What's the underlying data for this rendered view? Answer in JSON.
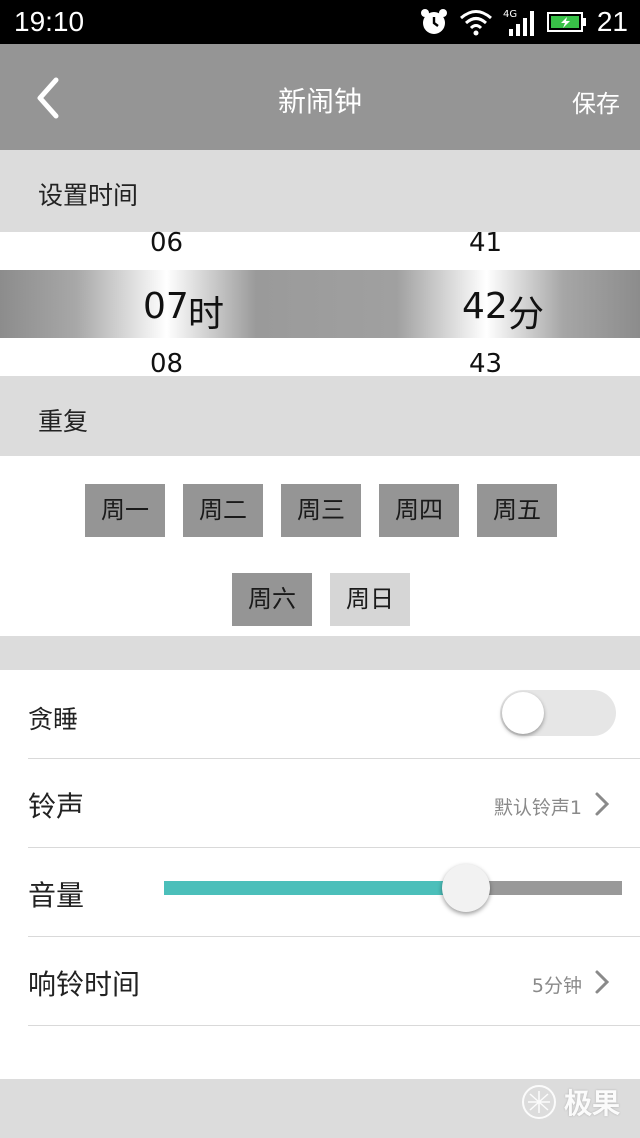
{
  "status_bar": {
    "time": "19:10",
    "network": "4G",
    "battery": "21",
    "icons": [
      "alarm-icon",
      "wifi-icon",
      "signal-icon",
      "battery-icon"
    ]
  },
  "app_bar": {
    "title": "新闹钟",
    "save_label": "保存",
    "back_icon": "chevron-left-icon"
  },
  "set_time": {
    "label": "设置时间",
    "hour": {
      "prev": "06",
      "selected": "07",
      "unit": "时",
      "next": "08"
    },
    "minute": {
      "prev": "41",
      "selected": "42",
      "unit": "分",
      "next": "43"
    }
  },
  "repeat": {
    "label": "重复",
    "days": [
      {
        "label": "周一",
        "selected": true
      },
      {
        "label": "周二",
        "selected": true
      },
      {
        "label": "周三",
        "selected": true
      },
      {
        "label": "周四",
        "selected": true
      },
      {
        "label": "周五",
        "selected": true
      },
      {
        "label": "周六",
        "selected": true
      },
      {
        "label": "周日",
        "selected": false
      }
    ]
  },
  "settings": {
    "snooze": {
      "label": "贪睡",
      "enabled": false
    },
    "ringtone": {
      "label": "铃声",
      "value": "默认铃声1"
    },
    "volume": {
      "label": "音量",
      "level": 0.66
    },
    "ring_duration": {
      "label": "响铃时间",
      "value": "5分钟"
    }
  },
  "watermark": {
    "text": "极果"
  },
  "colors": {
    "app_bar": "#959595",
    "section_bg": "#dcdcdc",
    "accent": "#4bbfba"
  }
}
